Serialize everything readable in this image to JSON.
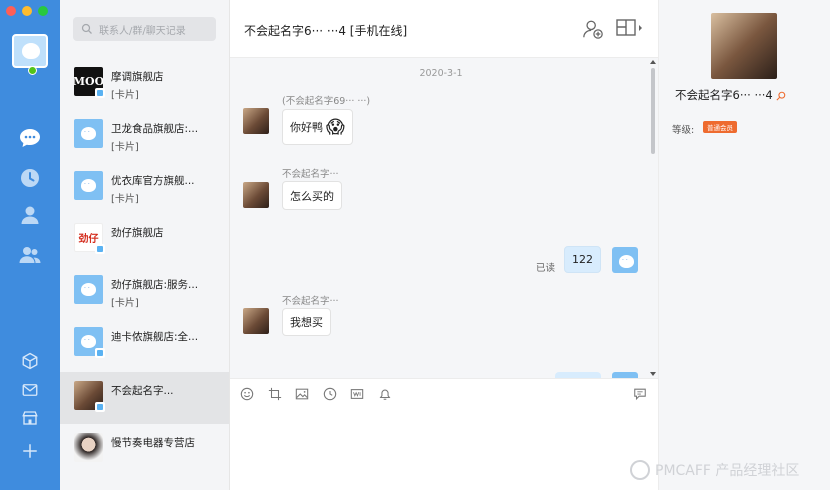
{
  "window": {
    "controls": [
      "close",
      "minimize",
      "zoom"
    ],
    "colors": {
      "close": "#fe5f57",
      "minimize": "#febc2e",
      "zoom": "#28c840"
    }
  },
  "rail": {
    "top_icons": [
      "chat-icon",
      "clock-icon",
      "contact-icon",
      "group-icon"
    ],
    "bottom_icons": [
      "cube-icon",
      "mail-icon",
      "store-icon",
      "plus-icon"
    ],
    "accent": "#3f8cde"
  },
  "search": {
    "placeholder": "联系人/群/聊天记录"
  },
  "conversations": [
    {
      "name": "摩调旗舰店",
      "sub": "[卡片]",
      "avatar": "MOO"
    },
    {
      "name": "卫龙食品旗舰店:...",
      "sub": "[卡片]",
      "avatar": ""
    },
    {
      "name": "优衣库官方旗舰...",
      "sub": "[卡片]",
      "avatar": ""
    },
    {
      "name": "劲仔旗舰店",
      "sub": "",
      "avatar": "劲仔"
    },
    {
      "name": "劲仔旗舰店:服务...",
      "sub": "[卡片]",
      "avatar": ""
    },
    {
      "name": "迪卡侬旗舰店:全...",
      "sub": "",
      "avatar": ""
    },
    {
      "name": "不会起名字...",
      "sub": "",
      "avatar": ""
    },
    {
      "name": "慢节奏电器专营店",
      "sub": "",
      "avatar": ""
    }
  ],
  "chat": {
    "title": "不会起名字6··· ···4 [手机在线]",
    "date": "2020-3-1",
    "messages": [
      {
        "sender": "(不会起名字69··· ···)",
        "text": "你好鸭",
        "emoji": "😱",
        "mine": false
      },
      {
        "sender": "不会起名字···",
        "text": "怎么买的",
        "mine": false
      },
      {
        "text": "122",
        "mine": true,
        "status": "已读"
      },
      {
        "sender": "不会起名字···",
        "text": "我想买",
        "mine": false
      }
    ],
    "toolbar_icons": [
      "emoji-icon",
      "crop-icon",
      "image-icon",
      "history-icon",
      "product-icon",
      "bell-icon"
    ],
    "history_icon": "message-history-icon"
  },
  "profile": {
    "name": "不会起名字6··· ···4",
    "level_label": "等级:",
    "level_tag": "普通会员"
  },
  "watermark": "PMCAFF 产品经理社区"
}
